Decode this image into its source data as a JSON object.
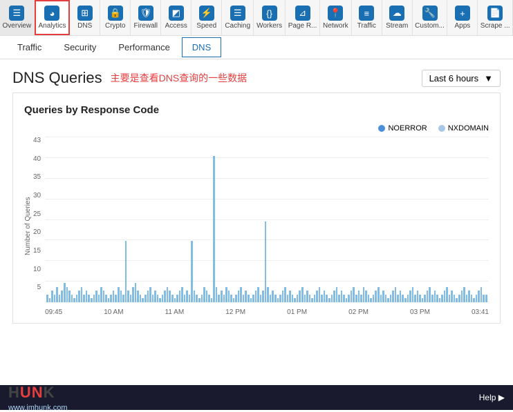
{
  "topnav": {
    "items": [
      {
        "id": "overview",
        "label": "Overview",
        "icon": "☰",
        "active": false
      },
      {
        "id": "analytics",
        "label": "Analytics",
        "icon": "◕",
        "active": true
      },
      {
        "id": "dns",
        "label": "DNS",
        "icon": "⊞",
        "active": false
      },
      {
        "id": "crypto",
        "label": "Crypto",
        "icon": "🔒",
        "active": false
      },
      {
        "id": "firewall",
        "label": "Firewall",
        "icon": "🛡",
        "active": false
      },
      {
        "id": "access",
        "label": "Access",
        "icon": "◩",
        "active": false
      },
      {
        "id": "speed",
        "label": "Speed",
        "icon": "⚡",
        "active": false
      },
      {
        "id": "caching",
        "label": "Caching",
        "icon": "☰",
        "active": false
      },
      {
        "id": "workers",
        "label": "Workers",
        "icon": "{}",
        "active": false
      },
      {
        "id": "pagerules",
        "label": "Page R...",
        "icon": "⊿",
        "active": false
      },
      {
        "id": "network",
        "label": "Network",
        "icon": "📍",
        "active": false
      },
      {
        "id": "traffic",
        "label": "Traffic",
        "icon": "≡",
        "active": false
      },
      {
        "id": "stream",
        "label": "Stream",
        "icon": "☁",
        "active": false
      },
      {
        "id": "custom",
        "label": "Custom...",
        "icon": "🔧",
        "active": false
      },
      {
        "id": "apps",
        "label": "Apps",
        "icon": "+",
        "active": false
      },
      {
        "id": "scrape",
        "label": "Scrape ...",
        "icon": "📄",
        "active": false
      }
    ]
  },
  "subtabs": {
    "items": [
      {
        "id": "traffic",
        "label": "Traffic",
        "active": false
      },
      {
        "id": "security",
        "label": "Security",
        "active": false
      },
      {
        "id": "performance",
        "label": "Performance",
        "active": false
      },
      {
        "id": "dns",
        "label": "DNS",
        "active": true
      }
    ]
  },
  "page": {
    "title": "DNS Queries",
    "subtitle": "主要是查看DNS查询的一些数据",
    "time_selector": "Last 6 hours"
  },
  "chart": {
    "title": "Queries by Response Code",
    "legend": [
      {
        "label": "NOERROR",
        "color": "#4a90d9"
      },
      {
        "label": "NXDOMAIN",
        "color": "#a8c8e8"
      }
    ],
    "y_axis_label": "Number of Queries",
    "y_ticks": [
      "43",
      "40",
      "35",
      "30",
      "25",
      "20",
      "15",
      "10",
      "5",
      ""
    ],
    "x_labels": [
      "09:45",
      "10 AM",
      "11 AM",
      "12 PM",
      "01 PM",
      "02 PM",
      "03 PM",
      "03:41"
    ],
    "bars": [
      2,
      1,
      3,
      2,
      4,
      2,
      3,
      5,
      4,
      3,
      2,
      1,
      2,
      3,
      4,
      2,
      3,
      2,
      1,
      2,
      3,
      2,
      4,
      3,
      2,
      1,
      2,
      3,
      2,
      4,
      3,
      2,
      16,
      3,
      2,
      4,
      5,
      3,
      2,
      1,
      2,
      3,
      4,
      2,
      3,
      2,
      1,
      2,
      3,
      4,
      3,
      2,
      1,
      2,
      3,
      4,
      2,
      3,
      2,
      16,
      3,
      2,
      1,
      2,
      4,
      3,
      2,
      1,
      38,
      4,
      2,
      3,
      2,
      4,
      3,
      2,
      1,
      2,
      3,
      4,
      2,
      3,
      2,
      1,
      2,
      3,
      4,
      2,
      3,
      21,
      4,
      2,
      3,
      2,
      1,
      2,
      3,
      4,
      2,
      3,
      2,
      1,
      2,
      3,
      4,
      2,
      3,
      2,
      1,
      2,
      3,
      4,
      2,
      3,
      2,
      1,
      2,
      3,
      4,
      2,
      3,
      2,
      1,
      2,
      3,
      4,
      2,
      3,
      2,
      4,
      3,
      2,
      1,
      2,
      3,
      4,
      2,
      3,
      2,
      1,
      2,
      3,
      4,
      2,
      3,
      2,
      1,
      2,
      3,
      4,
      2,
      3,
      2,
      1,
      2,
      3,
      4,
      2,
      3,
      2,
      1,
      2,
      3,
      4,
      2,
      3,
      2,
      1,
      2,
      3,
      4,
      2,
      3,
      2,
      1,
      2,
      3,
      4,
      2,
      2
    ]
  },
  "footer": {
    "logo": "HUNK",
    "url": "www.imhunk.com",
    "help_label": "Help ▶"
  }
}
